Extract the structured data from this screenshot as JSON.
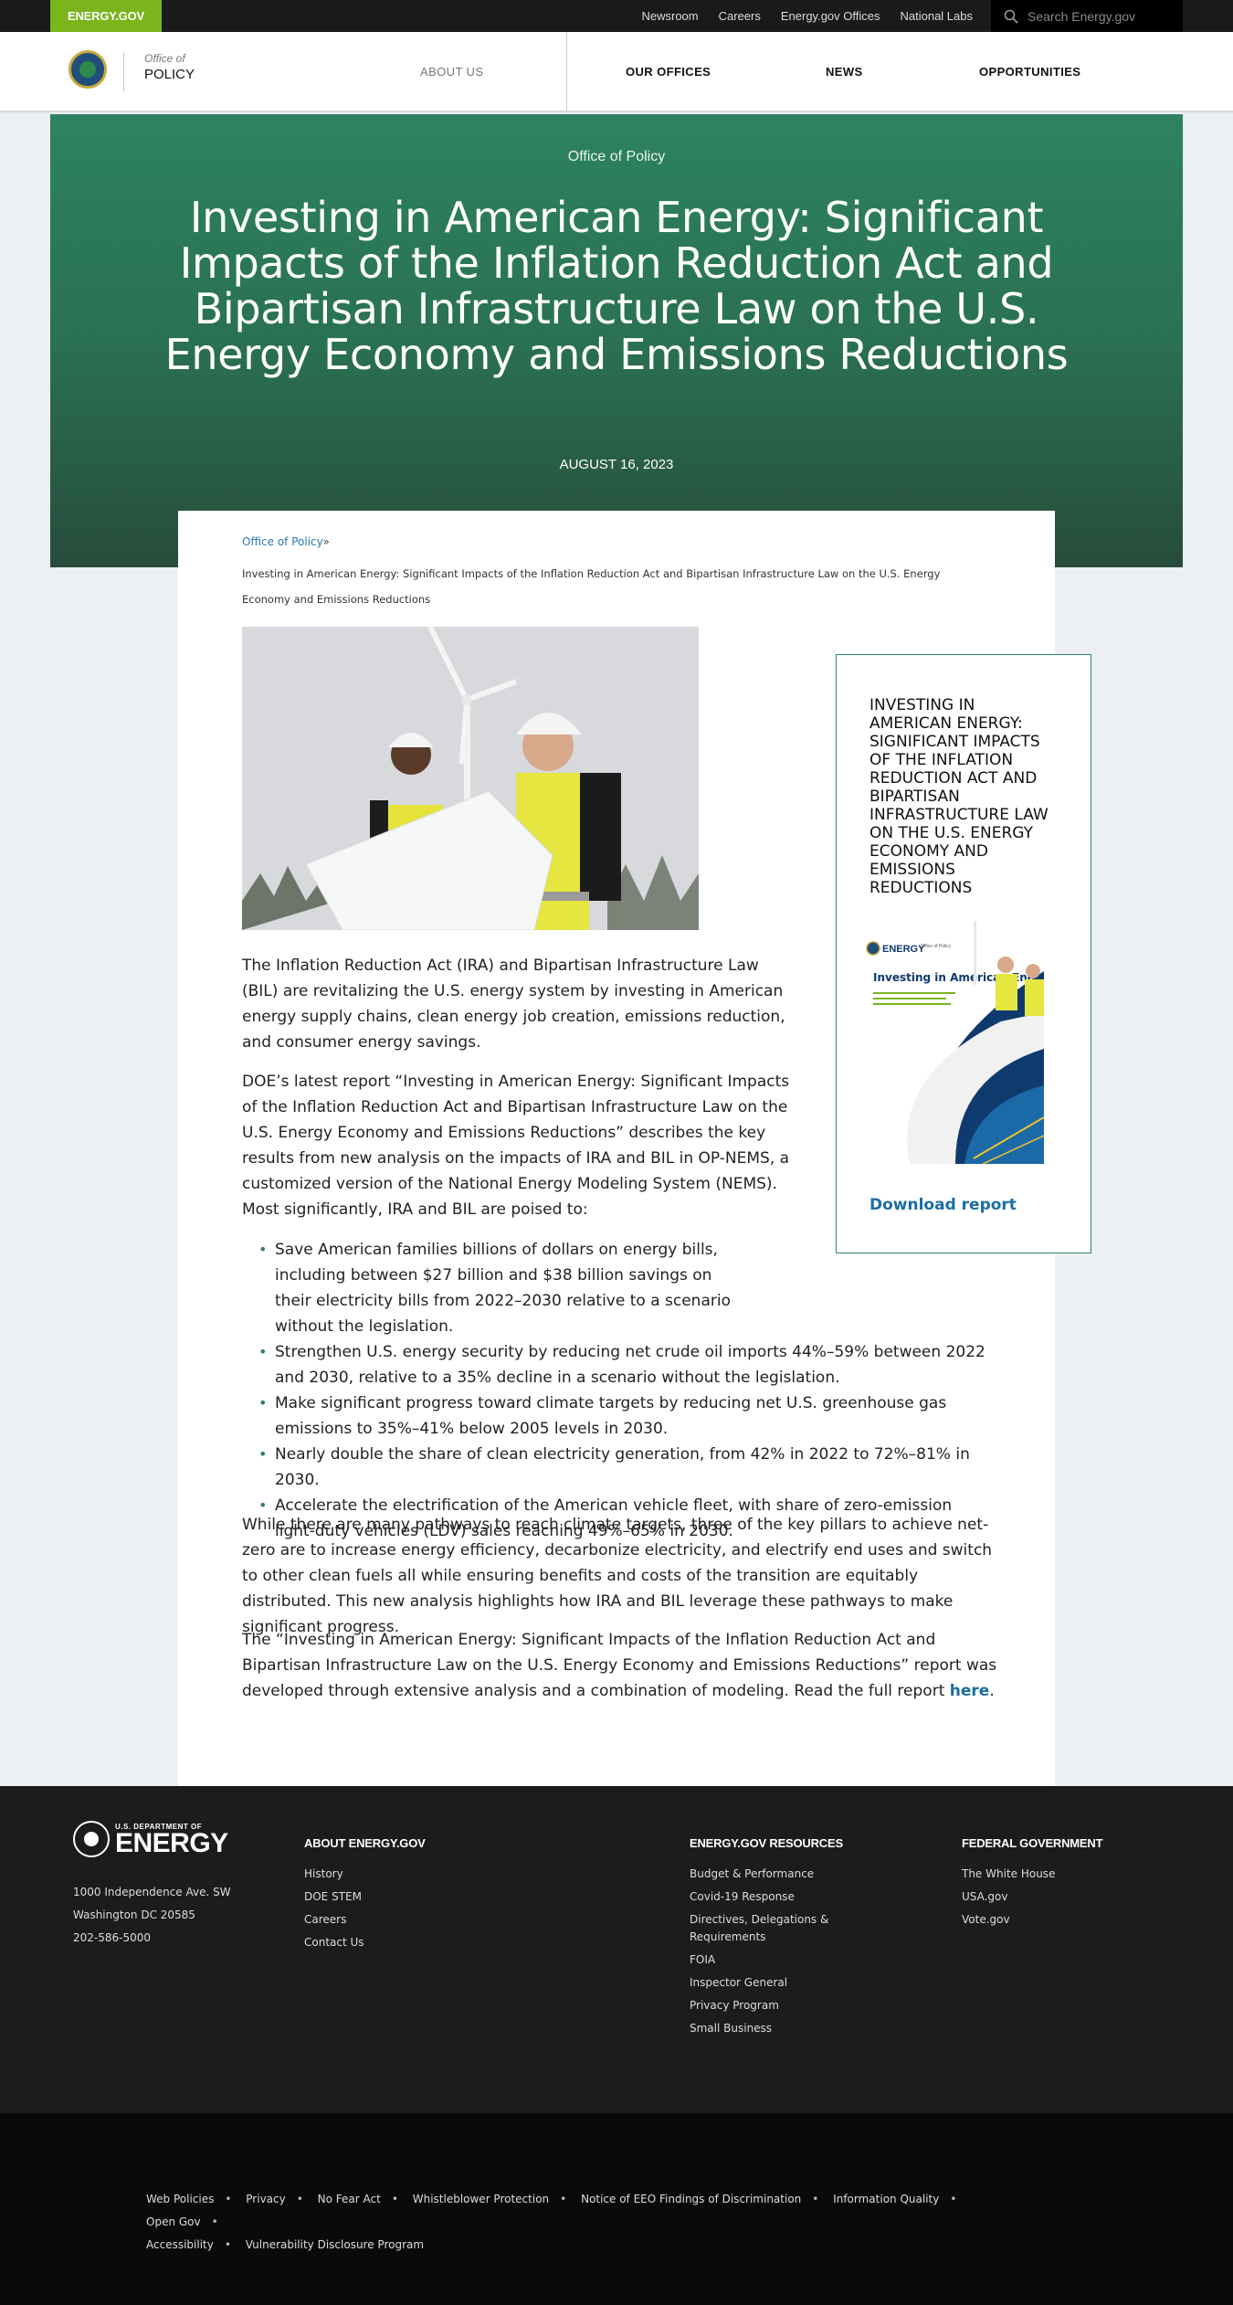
{
  "utility": {
    "brand": "ENERGY.GOV",
    "links": [
      "Newsroom",
      "Careers",
      "Energy.gov Offices",
      "National Labs"
    ],
    "search_placeholder": "Search Energy.gov"
  },
  "header": {
    "office_of": "Office of",
    "office_name": "POLICY",
    "nav": {
      "about": "ABOUT US",
      "offices": "OUR OFFICES",
      "news": "NEWS",
      "opportunities": "OPPORTUNITIES"
    }
  },
  "hero": {
    "kicker": "Office of Policy",
    "title": "Investing in American Energy: Significant Impacts of the Inflation Reduction Act and Bipartisan Infrastructure Law on the U.S. Energy Economy and Emissions Reductions",
    "date": "AUGUST 16, 2023"
  },
  "breadcrumb": {
    "parent": "Office of Policy",
    "separator": "»",
    "current": "Investing in American Energy: Significant Impacts of the Inflation Reduction Act and Bipartisan Infrastructure Law on the U.S. Energy Economy and Emissions Reductions"
  },
  "article": {
    "p1": "The Inflation Reduction Act (IRA) and Bipartisan Infrastructure Law (BIL) are revitalizing the U.S. energy system by investing in American energy supply chains, clean energy job creation, emissions reduction, and consumer energy savings.",
    "p2": "DOE’s latest report “Investing in American Energy: Significant Impacts of the Inflation Reduction Act and Bipartisan Infrastructure Law on the U.S. Energy Economy and Emissions Reductions” describes the key results from new analysis on the impacts of IRA and BIL in OP-NEMS, a customized version of the National Energy Modeling System (NEMS). Most significantly, IRA and BIL are poised to:",
    "bullets": [
      "Save American families billions of dollars on energy bills, including between $27 billion and $38 billion savings on their electricity bills from 2022–2030 relative to a scenario without the legislation.",
      "Strengthen U.S. energy security by reducing net crude oil imports 44%–59% between 2022 and 2030, relative to a 35% decline in a scenario without the legislation.",
      "Make significant progress toward climate targets by reducing net U.S. greenhouse gas emissions to 35%–41% below 2005 levels in 2030.",
      "Nearly double the share of clean electricity generation, from 42% in 2022 to 72%–81% in 2030.",
      "Accelerate the electrification of the American vehicle fleet, with share of zero-emission light-duty vehicles (LDV) sales reaching 49%–65% in 2030."
    ],
    "p3": "While there are many pathways to reach climate targets, three of the key pillars to achieve net-zero are to increase energy efficiency, decarbonize electricity, and electrify end uses and switch to other clean fuels all while ensuring benefits and costs of the transition are equitably distributed. This new analysis highlights how IRA and BIL leverage these pathways to make significant progress.",
    "p4": "The “Investing in American Energy: Significant Impacts of the Inflation Reduction Act and Bipartisan Infrastructure Law on the U.S. Energy Economy and Emissions Reductions” report was developed through extensive analysis and a combination of modeling. Read the full report",
    "p4_link": "here",
    "p4_end": "."
  },
  "sidebox": {
    "title": "Investing in American Energy: Significant Impacts of the Inflation Reduction Act and Bipartisan Infrastructure Law on the U.S. Energy Economy and Emissions Reductions",
    "cover_brand": "ENERGY",
    "cover_office": "Office of Policy",
    "cover_title": "Investing in American Energy",
    "download": "Download report"
  },
  "footer": {
    "logo_small": "U.S. DEPARTMENT OF",
    "logo_big": "ENERGY",
    "address": [
      "1000 Independence Ave. SW",
      "Washington DC 20585",
      "202-586-5000"
    ],
    "col1": {
      "title": "ABOUT ENERGY.GOV",
      "links": [
        "History",
        "DOE STEM",
        "Careers",
        "Contact Us"
      ]
    },
    "col2": {
      "title": "ENERGY.GOV RESOURCES",
      "links": [
        "Budget & Performance",
        "Covid-19 Response",
        "Directives, Delegations & Requirements",
        "FOIA",
        "Inspector General",
        "Privacy Program",
        "Small Business"
      ]
    },
    "col3": {
      "title": "FEDERAL GOVERNMENT",
      "links": [
        "The White House",
        "USA.gov",
        "Vote.gov"
      ]
    },
    "legal": [
      "Web Policies",
      "Privacy",
      "No Fear Act",
      "Whistleblower Protection",
      "Notice of EEO Findings of Discrimination",
      "Information Quality",
      "Open Gov",
      "Accessibility",
      "Vulnerability Disclosure Program"
    ]
  },
  "colors": {
    "brand_green": "#7ab51d",
    "hero_green": "#2d8361",
    "link_blue": "#1b6ea0",
    "footer_bg": "#1c1c1c"
  }
}
